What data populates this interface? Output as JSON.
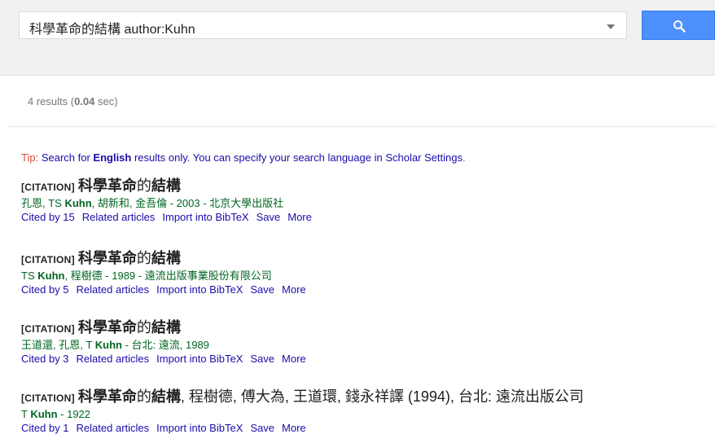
{
  "search": {
    "query": "科學革命的結構 author:Kuhn"
  },
  "results_info": {
    "count_text": "4 results (",
    "time": "0.04",
    "time_suffix": " sec)"
  },
  "tip": {
    "prefix": "Tip:",
    "text1": " Search for ",
    "english": "English",
    "text2": " results only. You can specify your search language in ",
    "settings_link": "Scholar Settings",
    "text3": "."
  },
  "results": [
    {
      "tag": "[CITATION]",
      "title_parts": [
        "科學革命",
        "的",
        "結構"
      ],
      "title_rest": "",
      "authors_pre": "孔恩, TS ",
      "authors_bold": "Kuhn",
      "authors_post": ", 胡新和, 金吾倫 - 2003 - 北京大學出版社",
      "links": [
        "Cited by 15",
        "Related articles",
        "Import into BibTeX",
        "Save",
        "More"
      ]
    },
    {
      "tag": "[CITATION]",
      "title_parts": [
        "科學革命",
        "的",
        "結構"
      ],
      "title_rest": "",
      "authors_pre": "TS ",
      "authors_bold": "Kuhn",
      "authors_post": ", 程樹德 - 1989 - 遠流出版事業股份有限公司",
      "links": [
        "Cited by 5",
        "Related articles",
        "Import into BibTeX",
        "Save",
        "More"
      ]
    },
    {
      "tag": "[CITATION]",
      "title_parts": [
        "科學革命",
        "的",
        "結構"
      ],
      "title_rest": "",
      "authors_pre": "王道還, 孔恩, T ",
      "authors_bold": "Kuhn",
      "authors_post": " - 台北: 遠流, 1989",
      "links": [
        "Cited by 3",
        "Related articles",
        "Import into BibTeX",
        "Save",
        "More"
      ]
    },
    {
      "tag": "[CITATION]",
      "title_parts": [
        "科學革命",
        "的",
        "結構"
      ],
      "title_rest": ", 程樹德, 傅大為, 王道環, 錢永祥譯 (1994), 台北: 遠流出版公司",
      "authors_pre": "T ",
      "authors_bold": "Kuhn",
      "authors_post": " - 1922",
      "links": [
        "Cited by 1",
        "Related articles",
        "Import into BibTeX",
        "Save",
        "More"
      ]
    }
  ]
}
